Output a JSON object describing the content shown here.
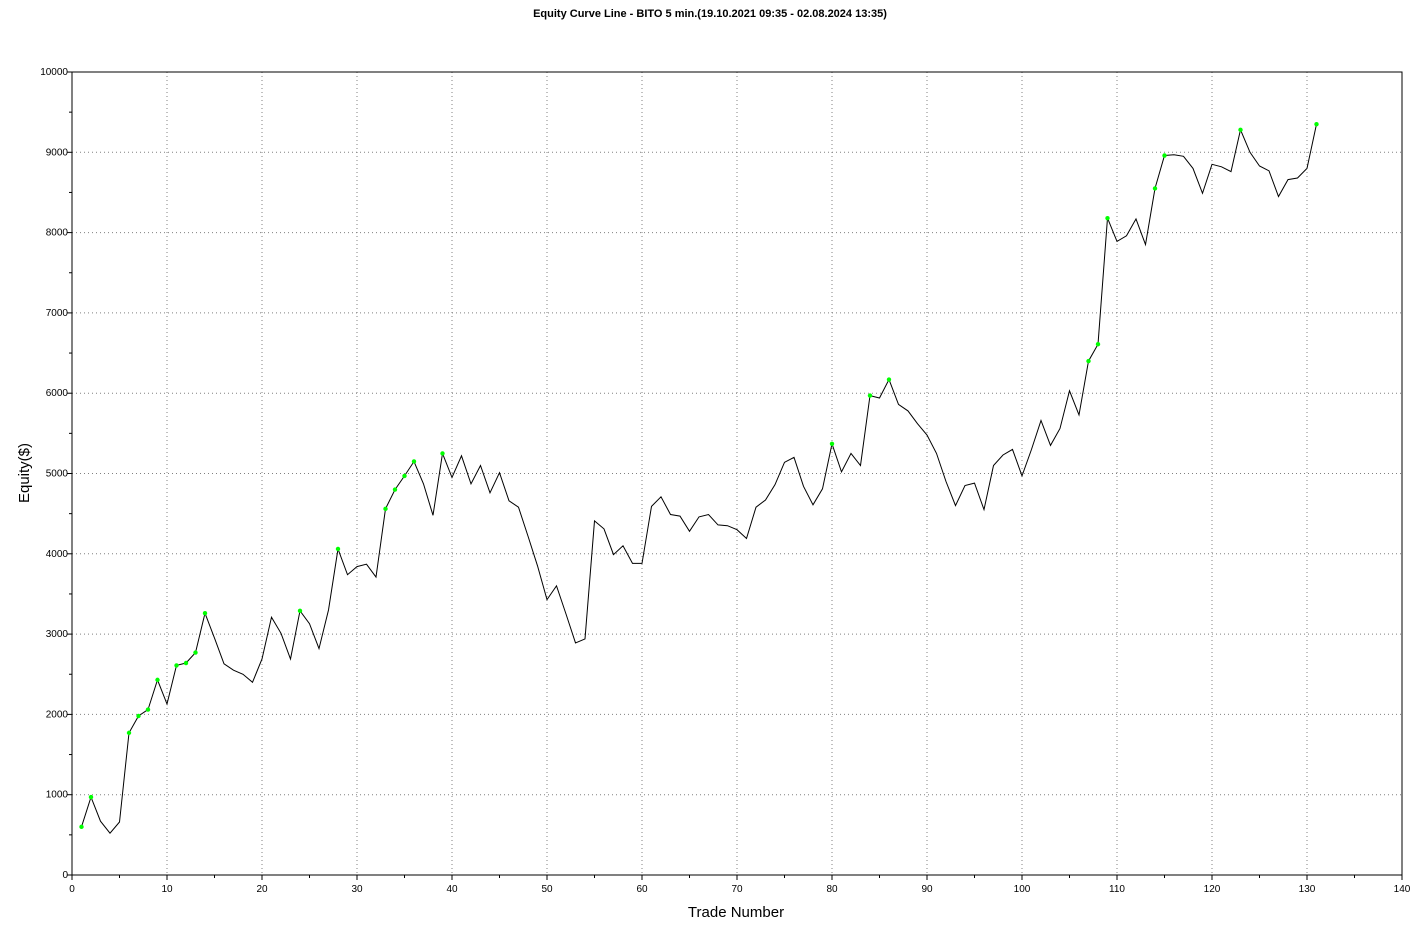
{
  "chart_data": {
    "type": "line",
    "title": "Equity Curve Line - BITO 5 min.(19.10.2021 09:35 - 02.08.2024 13:35)",
    "xlabel": "Trade Number",
    "ylabel": "Equity($)",
    "xlim": [
      0,
      140
    ],
    "ylim": [
      0,
      10000
    ],
    "x_ticks": [
      0,
      10,
      20,
      30,
      40,
      50,
      60,
      70,
      80,
      90,
      100,
      110,
      120,
      130,
      140
    ],
    "y_ticks": [
      0,
      1000,
      2000,
      3000,
      4000,
      5000,
      6000,
      7000,
      8000,
      9000,
      10000
    ],
    "grid": true,
    "colors": {
      "line": "#000000",
      "marker": "#00ff00",
      "grid": "#808080"
    },
    "series": [
      {
        "x": [
          1,
          2,
          3,
          4,
          5,
          6,
          7,
          8,
          9,
          10,
          11,
          12,
          13,
          14,
          15,
          16,
          17,
          18,
          19,
          20,
          21,
          22,
          23,
          24,
          25,
          26,
          27,
          28,
          29,
          30,
          31,
          32,
          33,
          34,
          35,
          36,
          37,
          38,
          39,
          40,
          41,
          42,
          43,
          44,
          45,
          46,
          47,
          48,
          49,
          50,
          51,
          52,
          53,
          54,
          55,
          56,
          57,
          58,
          59,
          60,
          61,
          62,
          63,
          64,
          65,
          66,
          67,
          68,
          69,
          70,
          71,
          72,
          73,
          74,
          75,
          76,
          77,
          78,
          79,
          80,
          81,
          82,
          83,
          84,
          85,
          86,
          87,
          88,
          89,
          90,
          91,
          92,
          93,
          94,
          95,
          96,
          97,
          98,
          99,
          100,
          101,
          102,
          103,
          104,
          105,
          106,
          107,
          108,
          109,
          110,
          111,
          112,
          113,
          114,
          115,
          116,
          117,
          118,
          119,
          120,
          121,
          122,
          123,
          124,
          125,
          126,
          127,
          128,
          129,
          130,
          131
        ],
        "y": [
          600,
          970,
          670,
          520,
          660,
          1770,
          1980,
          2060,
          2430,
          2130,
          2610,
          2640,
          2770,
          3260,
          2950,
          2630,
          2550,
          2500,
          2400,
          2690,
          3210,
          3010,
          2690,
          3290,
          3130,
          2820,
          3300,
          4060,
          3740,
          3840,
          3870,
          3710,
          4560,
          4800,
          4970,
          5150,
          4870,
          4480,
          5250,
          4950,
          5220,
          4870,
          5100,
          4760,
          5010,
          4660,
          4580,
          4220,
          3850,
          3430,
          3600,
          3250,
          2890,
          2940,
          4410,
          4310,
          3990,
          4100,
          3880,
          3880,
          4590,
          4710,
          4490,
          4470,
          4280,
          4460,
          4490,
          4360,
          4350,
          4300,
          4190,
          4580,
          4670,
          4860,
          5140,
          5200,
          4840,
          4610,
          4810,
          5370,
          5020,
          5250,
          5100,
          5970,
          5940,
          6170,
          5860,
          5780,
          5620,
          5480,
          5250,
          4900,
          4600,
          4850,
          4880,
          4550,
          5100,
          5230,
          5300,
          4970,
          5300,
          5660,
          5350,
          5560,
          6030,
          5730,
          6400,
          6610,
          8180,
          7890,
          7960,
          8170,
          7850,
          8550,
          8960,
          8970,
          8950,
          8800,
          8490,
          8850,
          8820,
          8760,
          9280,
          9000,
          8830,
          8770,
          8450,
          8660,
          8680,
          8800,
          9350
        ],
        "markers_at": [
          1,
          2,
          6,
          7,
          8,
          9,
          11,
          12,
          13,
          14,
          24,
          28,
          33,
          34,
          35,
          36,
          39,
          80,
          84,
          86,
          107,
          108,
          109,
          114,
          115,
          123,
          131
        ]
      }
    ]
  }
}
